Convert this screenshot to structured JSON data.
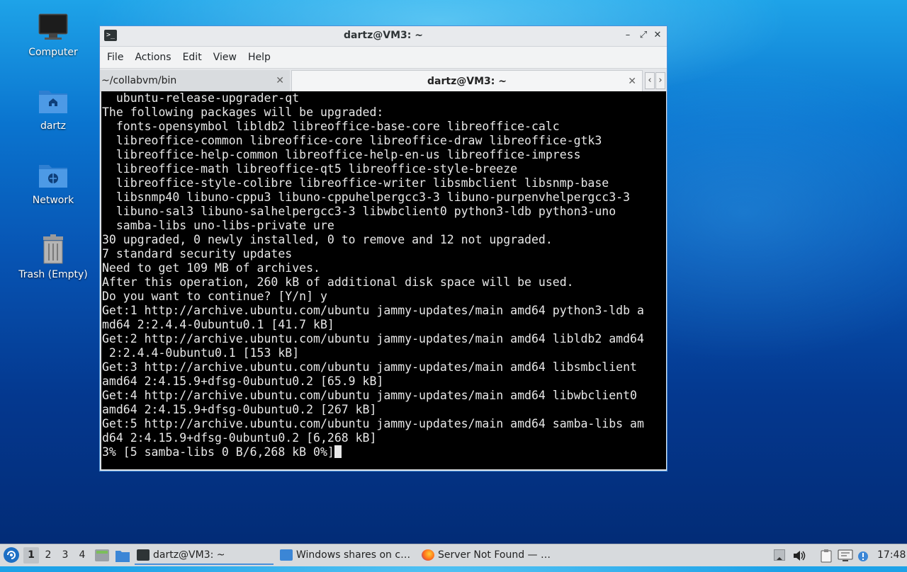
{
  "desktop": {
    "icons": [
      {
        "label": "Computer",
        "icon": "computer-icon"
      },
      {
        "label": "dartz",
        "icon": "home-folder-icon"
      },
      {
        "label": "Network",
        "icon": "network-folder-icon"
      },
      {
        "label": "Trash (Empty)",
        "icon": "trash-icon"
      }
    ]
  },
  "window": {
    "title": "dartz@VM3: ~",
    "controls": {
      "minimize": "–",
      "maximize": "⤢",
      "close": "✕"
    },
    "menu": [
      "File",
      "Actions",
      "Edit",
      "View",
      "Help"
    ],
    "tabs": [
      {
        "label": "~/collabvm/bin",
        "close": "✕"
      },
      {
        "label": "dartz@VM3: ~",
        "close": "✕"
      }
    ],
    "tab_nav": {
      "prev": "‹",
      "next": "›"
    }
  },
  "terminal": {
    "lines": [
      "  ubuntu-release-upgrader-qt",
      "The following packages will be upgraded:",
      "  fonts-opensymbol libldb2 libreoffice-base-core libreoffice-calc",
      "  libreoffice-common libreoffice-core libreoffice-draw libreoffice-gtk3",
      "  libreoffice-help-common libreoffice-help-en-us libreoffice-impress",
      "  libreoffice-math libreoffice-qt5 libreoffice-style-breeze",
      "  libreoffice-style-colibre libreoffice-writer libsmbclient libsnmp-base",
      "  libsnmp40 libuno-cppu3 libuno-cppuhelpergcc3-3 libuno-purpenvhelpergcc3-3",
      "  libuno-sal3 libuno-salhelpergcc3-3 libwbclient0 python3-ldb python3-uno",
      "  samba-libs uno-libs-private ure",
      "30 upgraded, 0 newly installed, 0 to remove and 12 not upgraded.",
      "7 standard security updates",
      "Need to get 109 MB of archives.",
      "After this operation, 260 kB of additional disk space will be used.",
      "Do you want to continue? [Y/n] y",
      "Get:1 http://archive.ubuntu.com/ubuntu jammy-updates/main amd64 python3-ldb a",
      "md64 2:2.4.4-0ubuntu0.1 [41.7 kB]",
      "Get:2 http://archive.ubuntu.com/ubuntu jammy-updates/main amd64 libldb2 amd64",
      " 2:2.4.4-0ubuntu0.1 [153 kB]",
      "Get:3 http://archive.ubuntu.com/ubuntu jammy-updates/main amd64 libsmbclient",
      "amd64 2:4.15.9+dfsg-0ubuntu0.2 [65.9 kB]",
      "Get:4 http://archive.ubuntu.com/ubuntu jammy-updates/main amd64 libwbclient0",
      "amd64 2:4.15.9+dfsg-0ubuntu0.2 [267 kB]",
      "Get:5 http://archive.ubuntu.com/ubuntu jammy-updates/main amd64 samba-libs am",
      "d64 2:4.15.9+dfsg-0ubuntu0.2 [6,268 kB]"
    ],
    "prompt_line": "3% [5 samba-libs 0 B/6,268 kB 0%]"
  },
  "taskbar": {
    "start_icon": "start-menu-icon",
    "workspaces": [
      "1",
      "2",
      "3",
      "4"
    ],
    "active_workspace": "1",
    "tasks": [
      {
        "label": "dartz@VM3: ~",
        "icon": "terminal-icon"
      },
      {
        "label": "Windows shares on c…",
        "icon": "folder-icon"
      },
      {
        "label": "Server Not Found — …",
        "icon": "firefox-icon"
      }
    ],
    "clock": "17:48"
  },
  "colors": {
    "accent": "#4a90d9",
    "terminal_bg": "#000000",
    "terminal_fg": "#e8e8e8"
  }
}
